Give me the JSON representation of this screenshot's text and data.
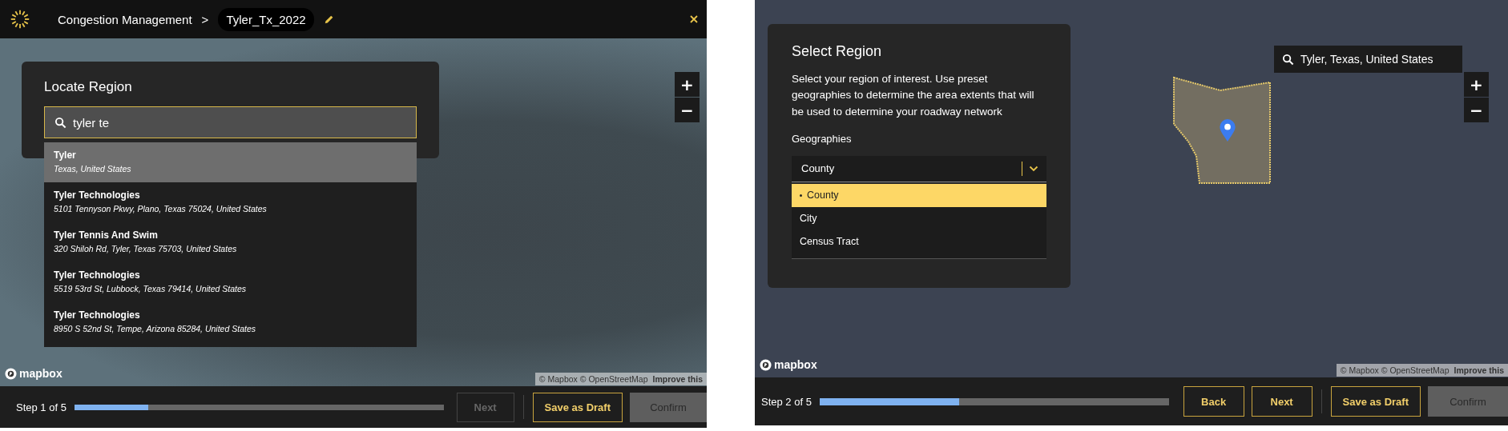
{
  "locate_screen": {
    "top_bar": {
      "app_title": "Congestion Management",
      "separator": ">",
      "project_name": "Tyler_Tx_2022"
    },
    "dialog": {
      "title": "Locate Region",
      "search": {
        "value": "tyler te"
      },
      "results": [
        {
          "name": "Tyler",
          "address": "Texas, United States",
          "selected": true
        },
        {
          "name": "Tyler Technologies",
          "address": "5101 Tennyson Pkwy, Plano, Texas 75024, United States",
          "selected": false
        },
        {
          "name": "Tyler Tennis And Swim",
          "address": "320 Shiloh Rd, Tyler, Texas 75703, United States",
          "selected": false
        },
        {
          "name": "Tyler Technologies",
          "address": "5519 53rd St, Lubbock, Texas 79414, United States",
          "selected": false
        },
        {
          "name": "Tyler Technologies",
          "address": "8950 S 52nd St, Tempe, Arizona 85284, United States",
          "selected": false
        }
      ]
    },
    "map": {
      "zoom_in": "+",
      "zoom_out": "−",
      "logo": "mapbox",
      "attribution": "© Mapbox © OpenStreetMap",
      "attribution_link": "Improve this"
    },
    "footer": {
      "step": "Step 1 of 5",
      "level": 0.2,
      "buttons": [
        {
          "label": "Next",
          "kind": "outline",
          "disabled": true
        },
        {
          "label": "Save as Draft",
          "kind": "outline",
          "disabled": false
        },
        {
          "label": "Confirm",
          "kind": "filled",
          "disabled": true
        }
      ]
    }
  },
  "select_screen": {
    "dialog": {
      "title": "Select Region",
      "description": "Select your region of interest. Use preset geographies to determine the area extents that will be used to determine your roadway network",
      "field_label": "Geographies",
      "select": {
        "value": "County",
        "expanded": true
      },
      "options": [
        {
          "label": "County",
          "selected": true
        },
        {
          "label": "City",
          "selected": false
        },
        {
          "label": "Census Tract",
          "selected": false
        }
      ]
    },
    "map_search": {
      "value": "Tyler, Texas, United States"
    },
    "map": {
      "zoom_in": "+",
      "zoom_out": "−",
      "logo": "mapbox",
      "attribution": "© Mapbox © OpenStreetMap",
      "attribution_link": "Improve this"
    },
    "footer": {
      "step": "Step 2 of 5",
      "level": 0.4,
      "buttons": [
        {
          "label": "Back",
          "kind": "outline",
          "disabled": false
        },
        {
          "label": "Next",
          "kind": "outline",
          "disabled": false
        },
        {
          "label": "Save as Draft",
          "kind": "outline",
          "disabled": false
        },
        {
          "label": "Confirm",
          "kind": "filled",
          "disabled": true
        }
      ]
    }
  }
}
